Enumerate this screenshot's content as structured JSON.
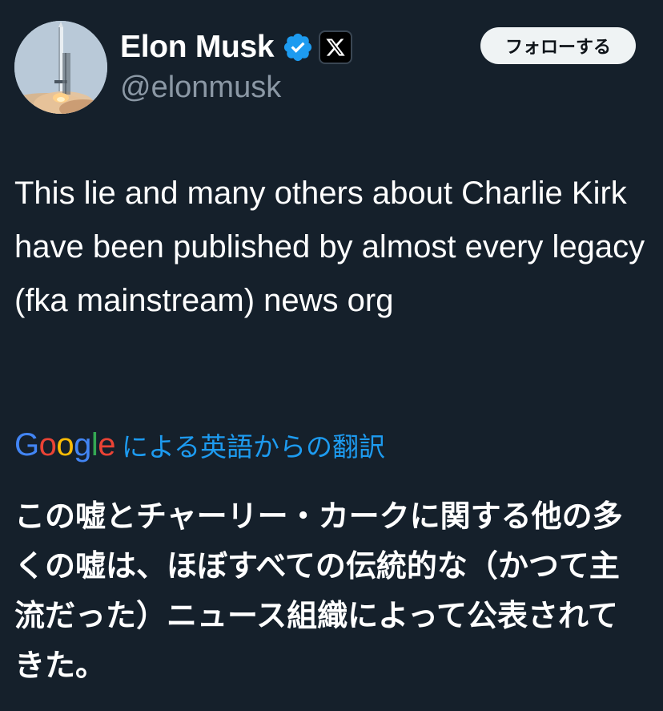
{
  "author": {
    "display_name": "Elon Musk",
    "handle": "@elonmusk",
    "avatar_icon": "rocket-launch-avatar",
    "verified_icon": "verified-badge-icon",
    "affiliation_icon": "x-logo-icon"
  },
  "follow_button": {
    "label": "フォローする"
  },
  "tweet": {
    "text": "This lie and many others about Charlie Kirk have been published by almost every legacy (fka mainstream) news org"
  },
  "translation": {
    "provider_letters": [
      "G",
      "o",
      "o",
      "g",
      "l",
      "e"
    ],
    "provider_colors": [
      "#4285F4",
      "#EA4335",
      "#FBBC05",
      "#4285F4",
      "#34A853",
      "#EA4335"
    ],
    "label": "による英語からの翻訳",
    "text": "この嘘とチャーリー・カークに関する他の多くの嘘は、ほぼすべての伝統的な（かつて主流だった）ニュース組織によって公表されてきた。"
  },
  "colors": {
    "background": "#15202b",
    "link_blue": "#1d9bf0",
    "secondary_text": "#8b98a5",
    "verified_blue": "#1d9bf0"
  }
}
